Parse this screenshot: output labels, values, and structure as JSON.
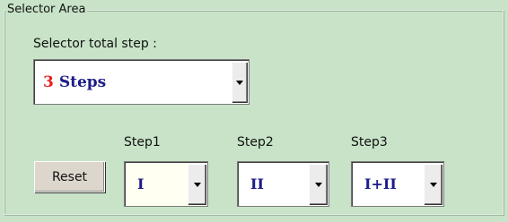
{
  "group": {
    "title": "Selector Area"
  },
  "total_step": {
    "label": "Selector total step :",
    "count": "3",
    "unit": "Steps",
    "count_color": "#e8201d",
    "text_color": "#1c1c88"
  },
  "steps": [
    {
      "label": "Step1",
      "value": "I"
    },
    {
      "label": "Step2",
      "value": "II"
    },
    {
      "label": "Step3",
      "value": "I+II"
    }
  ],
  "reset_button": {
    "label": "Reset"
  },
  "icons": {
    "dropdown": "triangle-down"
  },
  "colors": {
    "background": "#c8e3c8",
    "button_face": "#ddd6cc"
  }
}
